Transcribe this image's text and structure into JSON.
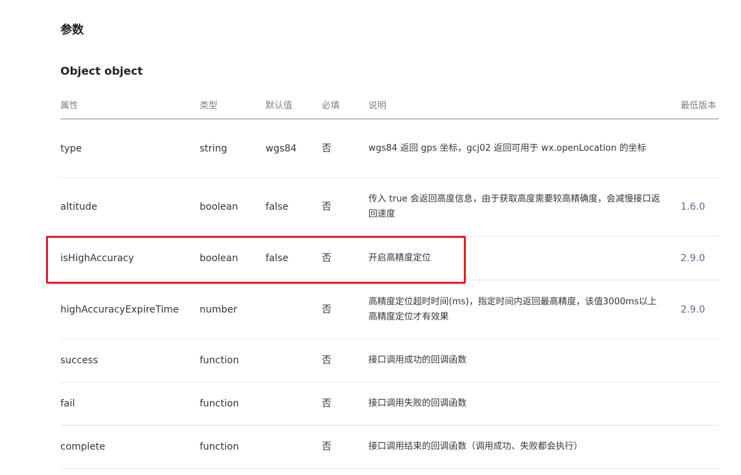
{
  "section_title": "参数",
  "object_title": "Object object",
  "table": {
    "headers": {
      "name": "属性",
      "type": "类型",
      "default": "默认值",
      "required": "必填",
      "description": "说明",
      "version": "最低版本"
    },
    "rows": [
      {
        "name": "type",
        "type": "string",
        "default": "wgs84",
        "required": "否",
        "description": "wgs84 返回 gps 坐标，gcj02 返回可用于 wx.openLocation 的坐标",
        "version": ""
      },
      {
        "name": "altitude",
        "type": "boolean",
        "default": "false",
        "required": "否",
        "description": "传入 true 会返回高度信息，由于获取高度需要较高精确度，会减慢接口返回速度",
        "version": "1.6.0"
      },
      {
        "name": "isHighAccuracy",
        "type": "boolean",
        "default": "false",
        "required": "否",
        "description": "开启高精度定位",
        "version": "2.9.0"
      },
      {
        "name": "highAccuracyExpireTime",
        "type": "number",
        "default": "",
        "required": "否",
        "description": "高精度定位超时时间(ms)，指定时间内返回最高精度，该值3000ms以上高精度定位才有效果",
        "version": "2.9.0"
      },
      {
        "name": "success",
        "type": "function",
        "default": "",
        "required": "否",
        "description": "接口调用成功的回调函数",
        "version": ""
      },
      {
        "name": "fail",
        "type": "function",
        "default": "",
        "required": "否",
        "description": "接口调用失败的回调函数",
        "version": ""
      },
      {
        "name": "complete",
        "type": "function",
        "default": "",
        "required": "否",
        "description": "接口调用结束的回调函数（调用成功、失败都会执行）",
        "version": ""
      }
    ]
  },
  "colors": {
    "highlight_border": "#e8202a",
    "version_link": "#576b95",
    "header_text": "#808080",
    "body_text": "#353535"
  }
}
